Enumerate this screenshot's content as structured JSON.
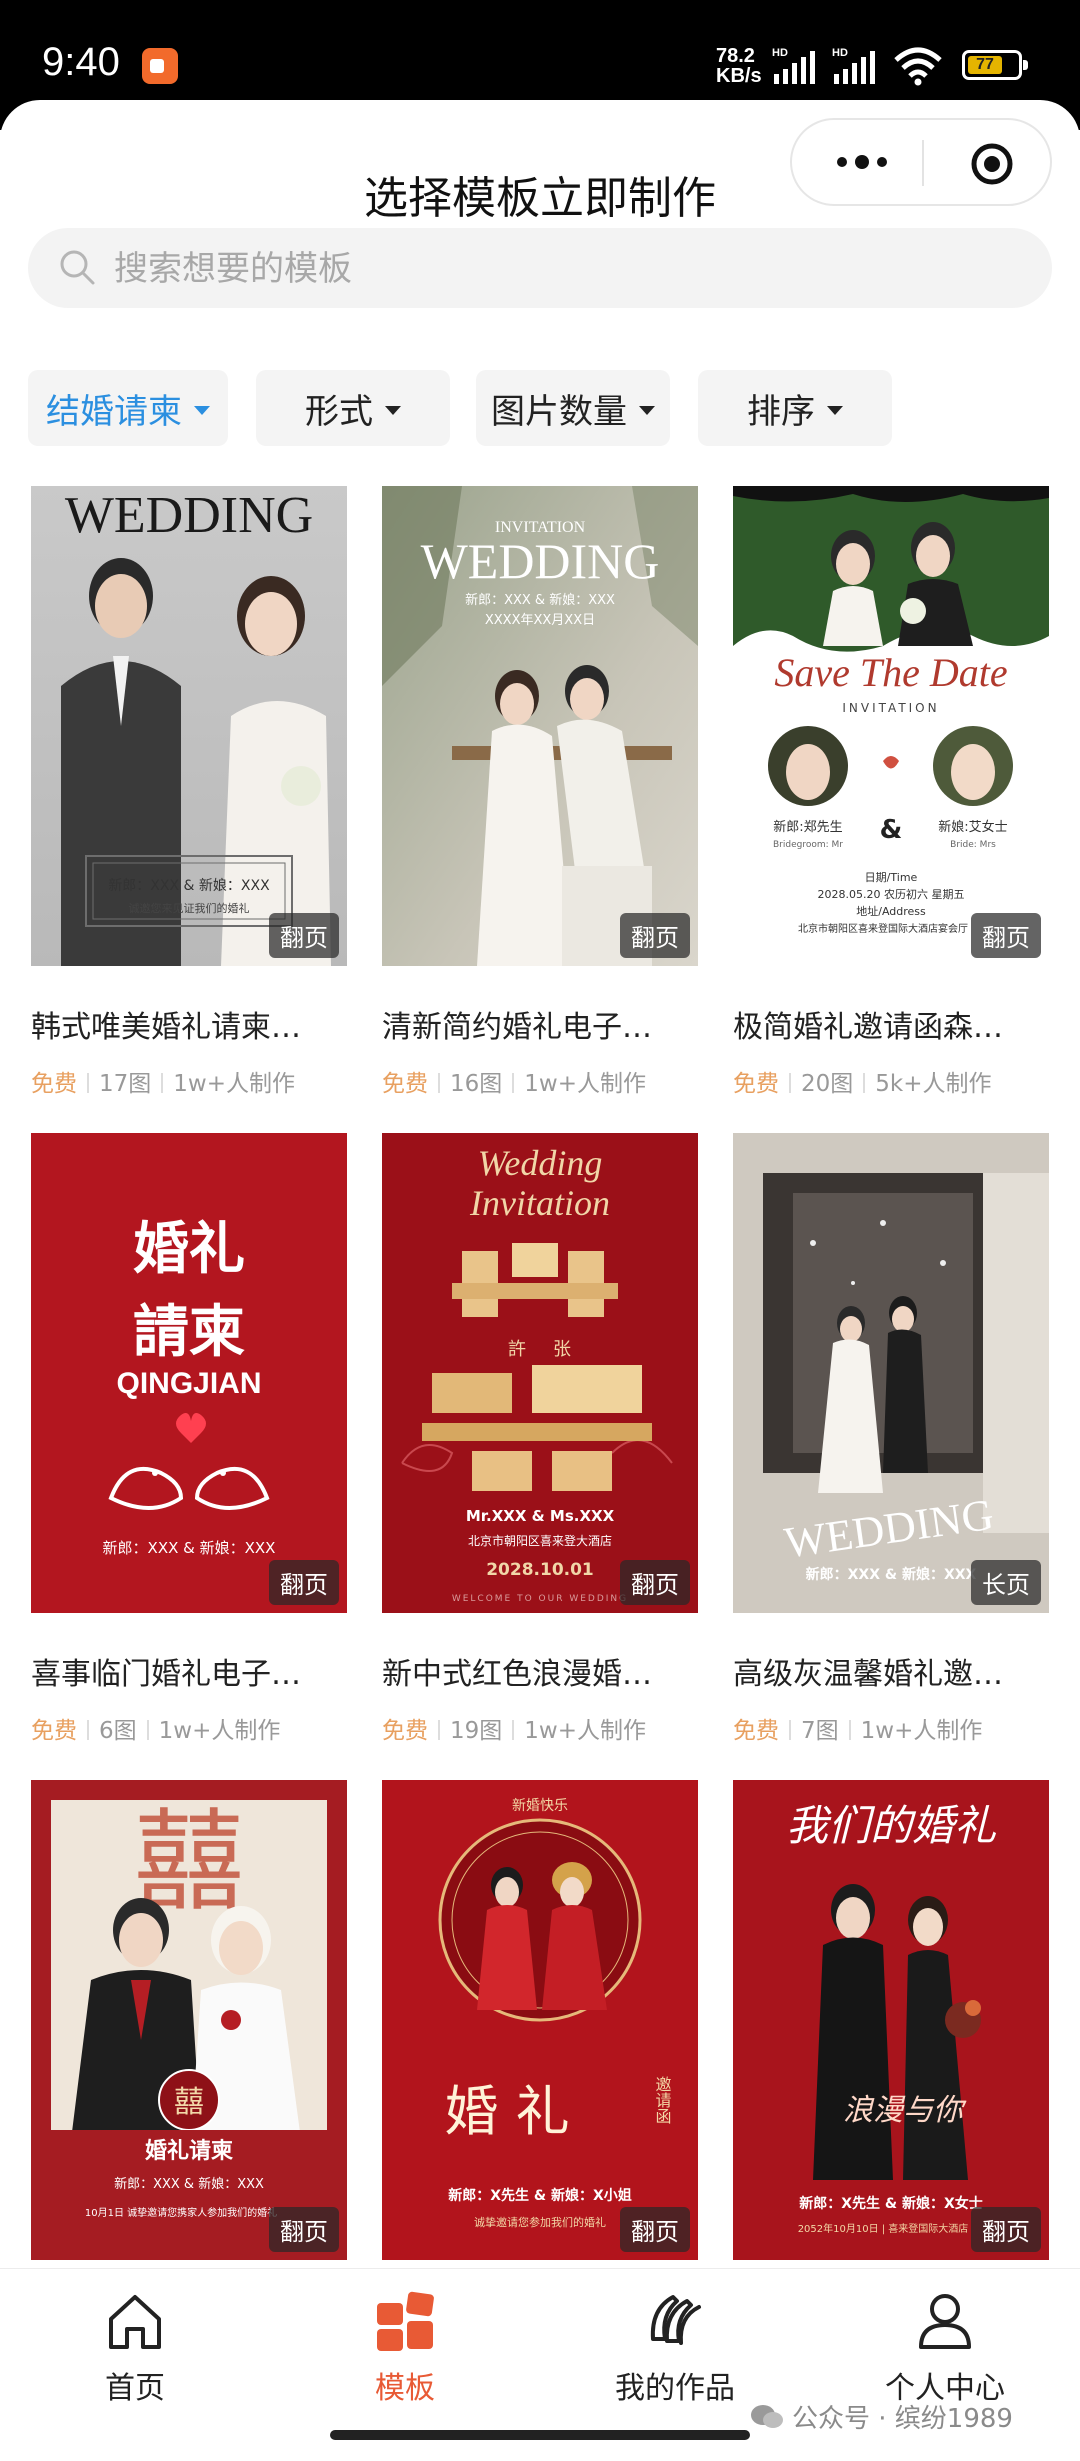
{
  "status": {
    "time": "9:40",
    "net_speed": "78.2",
    "net_unit": "KB/s",
    "sig1": "HD",
    "sig2": "HD",
    "battery": "77"
  },
  "header": {
    "title": "选择模板立即制作",
    "menu_icon": "more-dots-icon",
    "close_icon": "target-circle-icon"
  },
  "search": {
    "placeholder": "搜索想要的模板"
  },
  "filters": [
    {
      "label": "结婚请柬",
      "active": true
    },
    {
      "label": "形式"
    },
    {
      "label": "图片数量"
    },
    {
      "label": "排序"
    }
  ],
  "accent": "#2b8fe0",
  "brand": "#e85a35",
  "templates": [
    {
      "title": "韩式唯美婚礼请柬…",
      "price": "免费",
      "count": "17图",
      "makers": "1w+人制作",
      "tag": "翻页",
      "t1": "WEDDING",
      "t2": "新郎：XXX & 新娘：XXX",
      "t3": "诚邀您来见证我们的婚礼"
    },
    {
      "title": "清新简约婚礼电子…",
      "price": "免费",
      "count": "16图",
      "makers": "1w+人制作",
      "tag": "翻页",
      "t1": "INVITATION",
      "t2": "WEDDING",
      "t3": "新郎：XXX & 新娘：XXX",
      "t4": "XXXX年XX月XX日"
    },
    {
      "title": "极简婚礼邀请函森…",
      "price": "免费",
      "count": "20图",
      "makers": "5k+人制作",
      "tag": "翻页",
      "t1": "Save The Date",
      "t2": "INVITATION",
      "t3": "新郎:郑先生",
      "t4": "新娘:艾女士",
      "t5": "Bridegroom: Mr",
      "t6": "Bride: Mrs",
      "t7": "日期/Time",
      "t8": "2028.05.20 农历初六 星期五",
      "t9": "地址/Address",
      "t10": "北京市朝阳区喜来登国际大酒店宴会厅"
    },
    {
      "title": "喜事临门婚礼电子…",
      "price": "免费",
      "count": "6图",
      "makers": "1w+人制作",
      "tag": "翻页",
      "t1": "婚礼",
      "t2": "請柬",
      "t3": "QINGJIAN",
      "t4": "新郎：XXX & 新娘：XXX"
    },
    {
      "title": "新中式红色浪漫婚…",
      "price": "免费",
      "count": "19图",
      "makers": "1w+人制作",
      "tag": "翻页",
      "t1": "Wedding",
      "t2": "Invitation",
      "t3": "許",
      "t4": "张",
      "t5": "Mr.XXX & Ms.XXX",
      "t6": "北京市朝阳区喜来登大酒店",
      "t7": "2028.10.01",
      "t8": "WELCOME TO OUR WEDDING"
    },
    {
      "title": "高级灰温馨婚礼邀…",
      "price": "免费",
      "count": "7图",
      "makers": "1w+人制作",
      "tag": "长页",
      "t1": "WEDDING",
      "t2": "新郎：XXX & 新娘：XXX"
    },
    {
      "title": "",
      "price": "",
      "count": "",
      "makers": "",
      "tag": "翻页",
      "t1": "囍",
      "t2": "婚礼请柬",
      "t3": "新郎：XXX & 新娘：XXX",
      "t4": "10月1日 诚挚邀请您携家人参加我们的婚礼"
    },
    {
      "title": "",
      "price": "",
      "count": "",
      "makers": "",
      "tag": "翻页",
      "t1": "新婚快乐",
      "t2": "婚 礼",
      "t3": "邀请函",
      "t4": "新郎：X先生 & 新娘：X小姐",
      "t5": "诚挚邀请您参加我们的婚礼"
    },
    {
      "title": "",
      "price": "",
      "count": "",
      "makers": "",
      "tag": "翻页",
      "t1": "我们的婚礼",
      "t2": "浪漫与你",
      "t3": "新郎：X先生 & 新娘：X女士",
      "t4": "2052年10月10日 | 喜来登国际大酒店"
    }
  ],
  "tabs": [
    {
      "label": "首页",
      "icon": "home-icon"
    },
    {
      "label": "模板",
      "icon": "template-grid-icon",
      "active": true
    },
    {
      "label": "我的作品",
      "icon": "my-works-icon"
    },
    {
      "label": "个人中心",
      "icon": "user-icon"
    }
  ],
  "watermark": "公众号 · 缤纷1989"
}
